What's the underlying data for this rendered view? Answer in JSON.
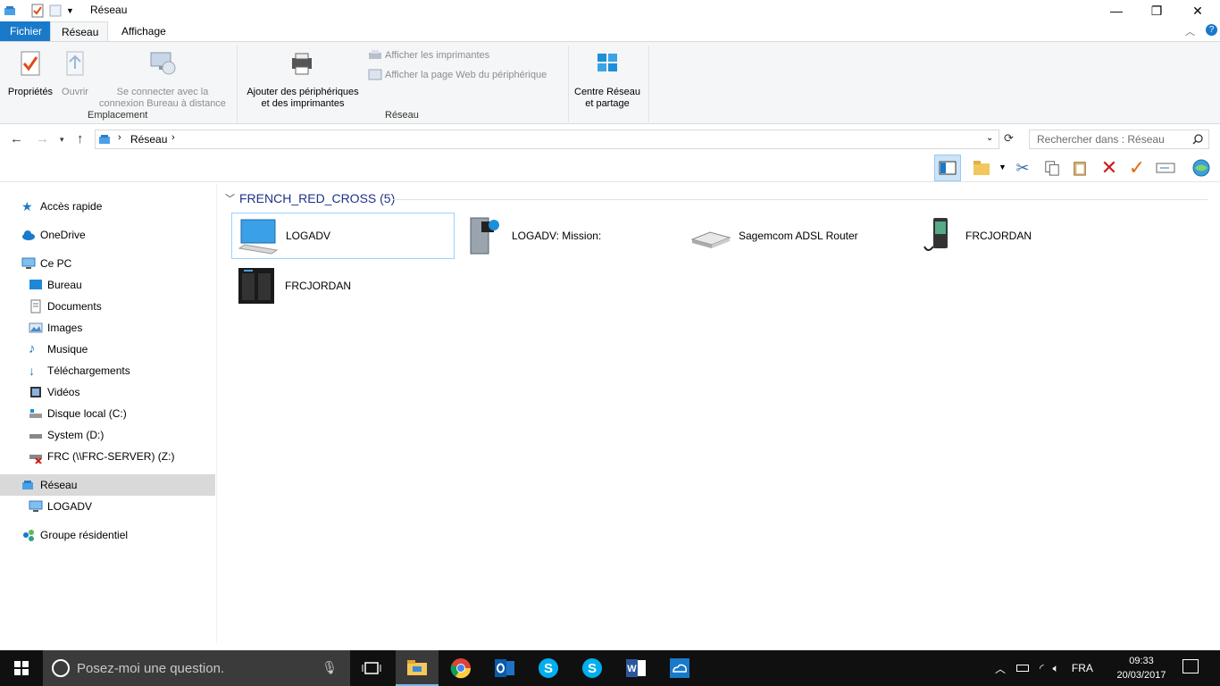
{
  "window": {
    "title": "Réseau",
    "controls": {
      "minimize": "—",
      "restore": "❐",
      "close": "✕"
    }
  },
  "tabs": {
    "file": "Fichier",
    "network": "Réseau",
    "view": "Affichage"
  },
  "ribbon": {
    "properties": "Propriétés",
    "open": "Ouvrir",
    "remote_line1": "Se connecter avec la",
    "remote_line2": "connexion Bureau à distance",
    "group_location": "Emplacement",
    "add_devices_line1": "Ajouter des périphériques",
    "add_devices_line2": "et des imprimantes",
    "show_printers": "Afficher les imprimantes",
    "show_device_web": "Afficher la page Web du périphérique",
    "group_network": "Réseau",
    "center_line1": "Centre Réseau",
    "center_line2": "et partage"
  },
  "address": {
    "crumb": "Réseau",
    "search_placeholder": "Rechercher dans : Réseau"
  },
  "nav": {
    "quick_access": "Accès rapide",
    "onedrive": "OneDrive",
    "this_pc": "Ce PC",
    "desktop": "Bureau",
    "documents": "Documents",
    "images": "Images",
    "music": "Musique",
    "downloads": "Téléchargements",
    "videos": "Vidéos",
    "local_disk": "Disque local (C:)",
    "system_d": "System (D:)",
    "frc_z": "FRC (\\\\FRC-SERVER) (Z:)",
    "network": "Réseau",
    "logadv": "LOGADV",
    "homegroup": "Groupe résidentiel"
  },
  "content": {
    "group_header": "FRENCH_RED_CROSS (5)",
    "items": [
      {
        "label": "LOGADV",
        "icon": "computer-icon"
      },
      {
        "label": "LOGADV: Mission:",
        "icon": "media-server-icon"
      },
      {
        "label": "Sagemcom ADSL Router",
        "icon": "router-icon"
      },
      {
        "label": "FRCJORDAN",
        "icon": "media-player-icon"
      },
      {
        "label": "FRCJORDAN",
        "icon": "nas-icon"
      }
    ]
  },
  "taskbar": {
    "search_placeholder": "Posez-moi une question.",
    "language": "FRA",
    "time": "09:33",
    "date": "20/03/2017"
  },
  "colors": {
    "accent": "#1979ca",
    "taskbar": "#101010",
    "selection": "#99d1ff"
  }
}
